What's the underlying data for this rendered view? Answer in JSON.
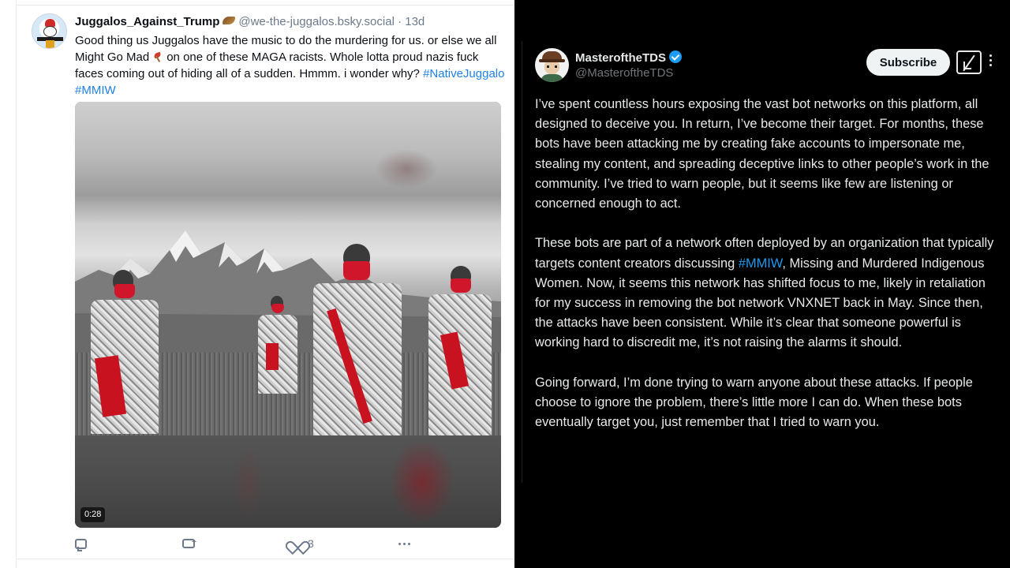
{
  "left_post": {
    "author_name": "Juggalos_Against_Trump",
    "handle_time": "@we-the-juggalos.bsky.social · 13d",
    "text": {
      "part1": "Good thing us Juggalos have the music to do the murdering for us. or else we all Might Go Mad",
      "part2": "on one of these MAGA racists. Whole lotta proud nazis fuck faces coming out of hiding all of a sudden. Hmmm. i wonder why?",
      "hashtag1": "#NativeJuggalo",
      "hashtag2": "#MMIW"
    },
    "video_duration": "0:28",
    "actions": {
      "likes": "3"
    },
    "icons": [
      "feather-icon",
      "axe-icon",
      "reply-icon",
      "repost-icon",
      "like-icon",
      "more-icon"
    ]
  },
  "right_post": {
    "display_name": "MasteroftheTDS",
    "handle": "@MasteroftheTDS",
    "subscribe_label": "Subscribe",
    "paragraphs": {
      "p1": "I’ve spent countless hours exposing the vast bot networks on this platform, all designed to deceive you. In return, I’ve become their target. For months, these bots have been attacking me by creating fake accounts to impersonate me, stealing my content, and spreading deceptive links to other people’s work in the community. I’ve tried to warn people, but it seems like few are listening or concerned enough to act.",
      "p2_before": "These bots are part of a network often deployed by an organization that typically targets content creators discussing ",
      "p2_link": "#MMIW",
      "p2_after": ", Missing and Murdered Indigenous Women. Now, it seems this network has shifted focus to me, likely in retaliation for my success in removing the bot network VNXNET back in May. Since then, the attacks have been consistent. While it’s clear that someone powerful is working hard to discredit me, it’s not raising the alarms it should.",
      "p3": "Going forward, I’m done trying to warn anyone about these attacks. If people choose to ignore the problem, there’s little more I can do. When these bots eventually target you, just remember that I tried to warn you."
    },
    "colors": {
      "link": "#1d9bf0",
      "verified": "#1d9bf0",
      "background": "#000000"
    }
  }
}
